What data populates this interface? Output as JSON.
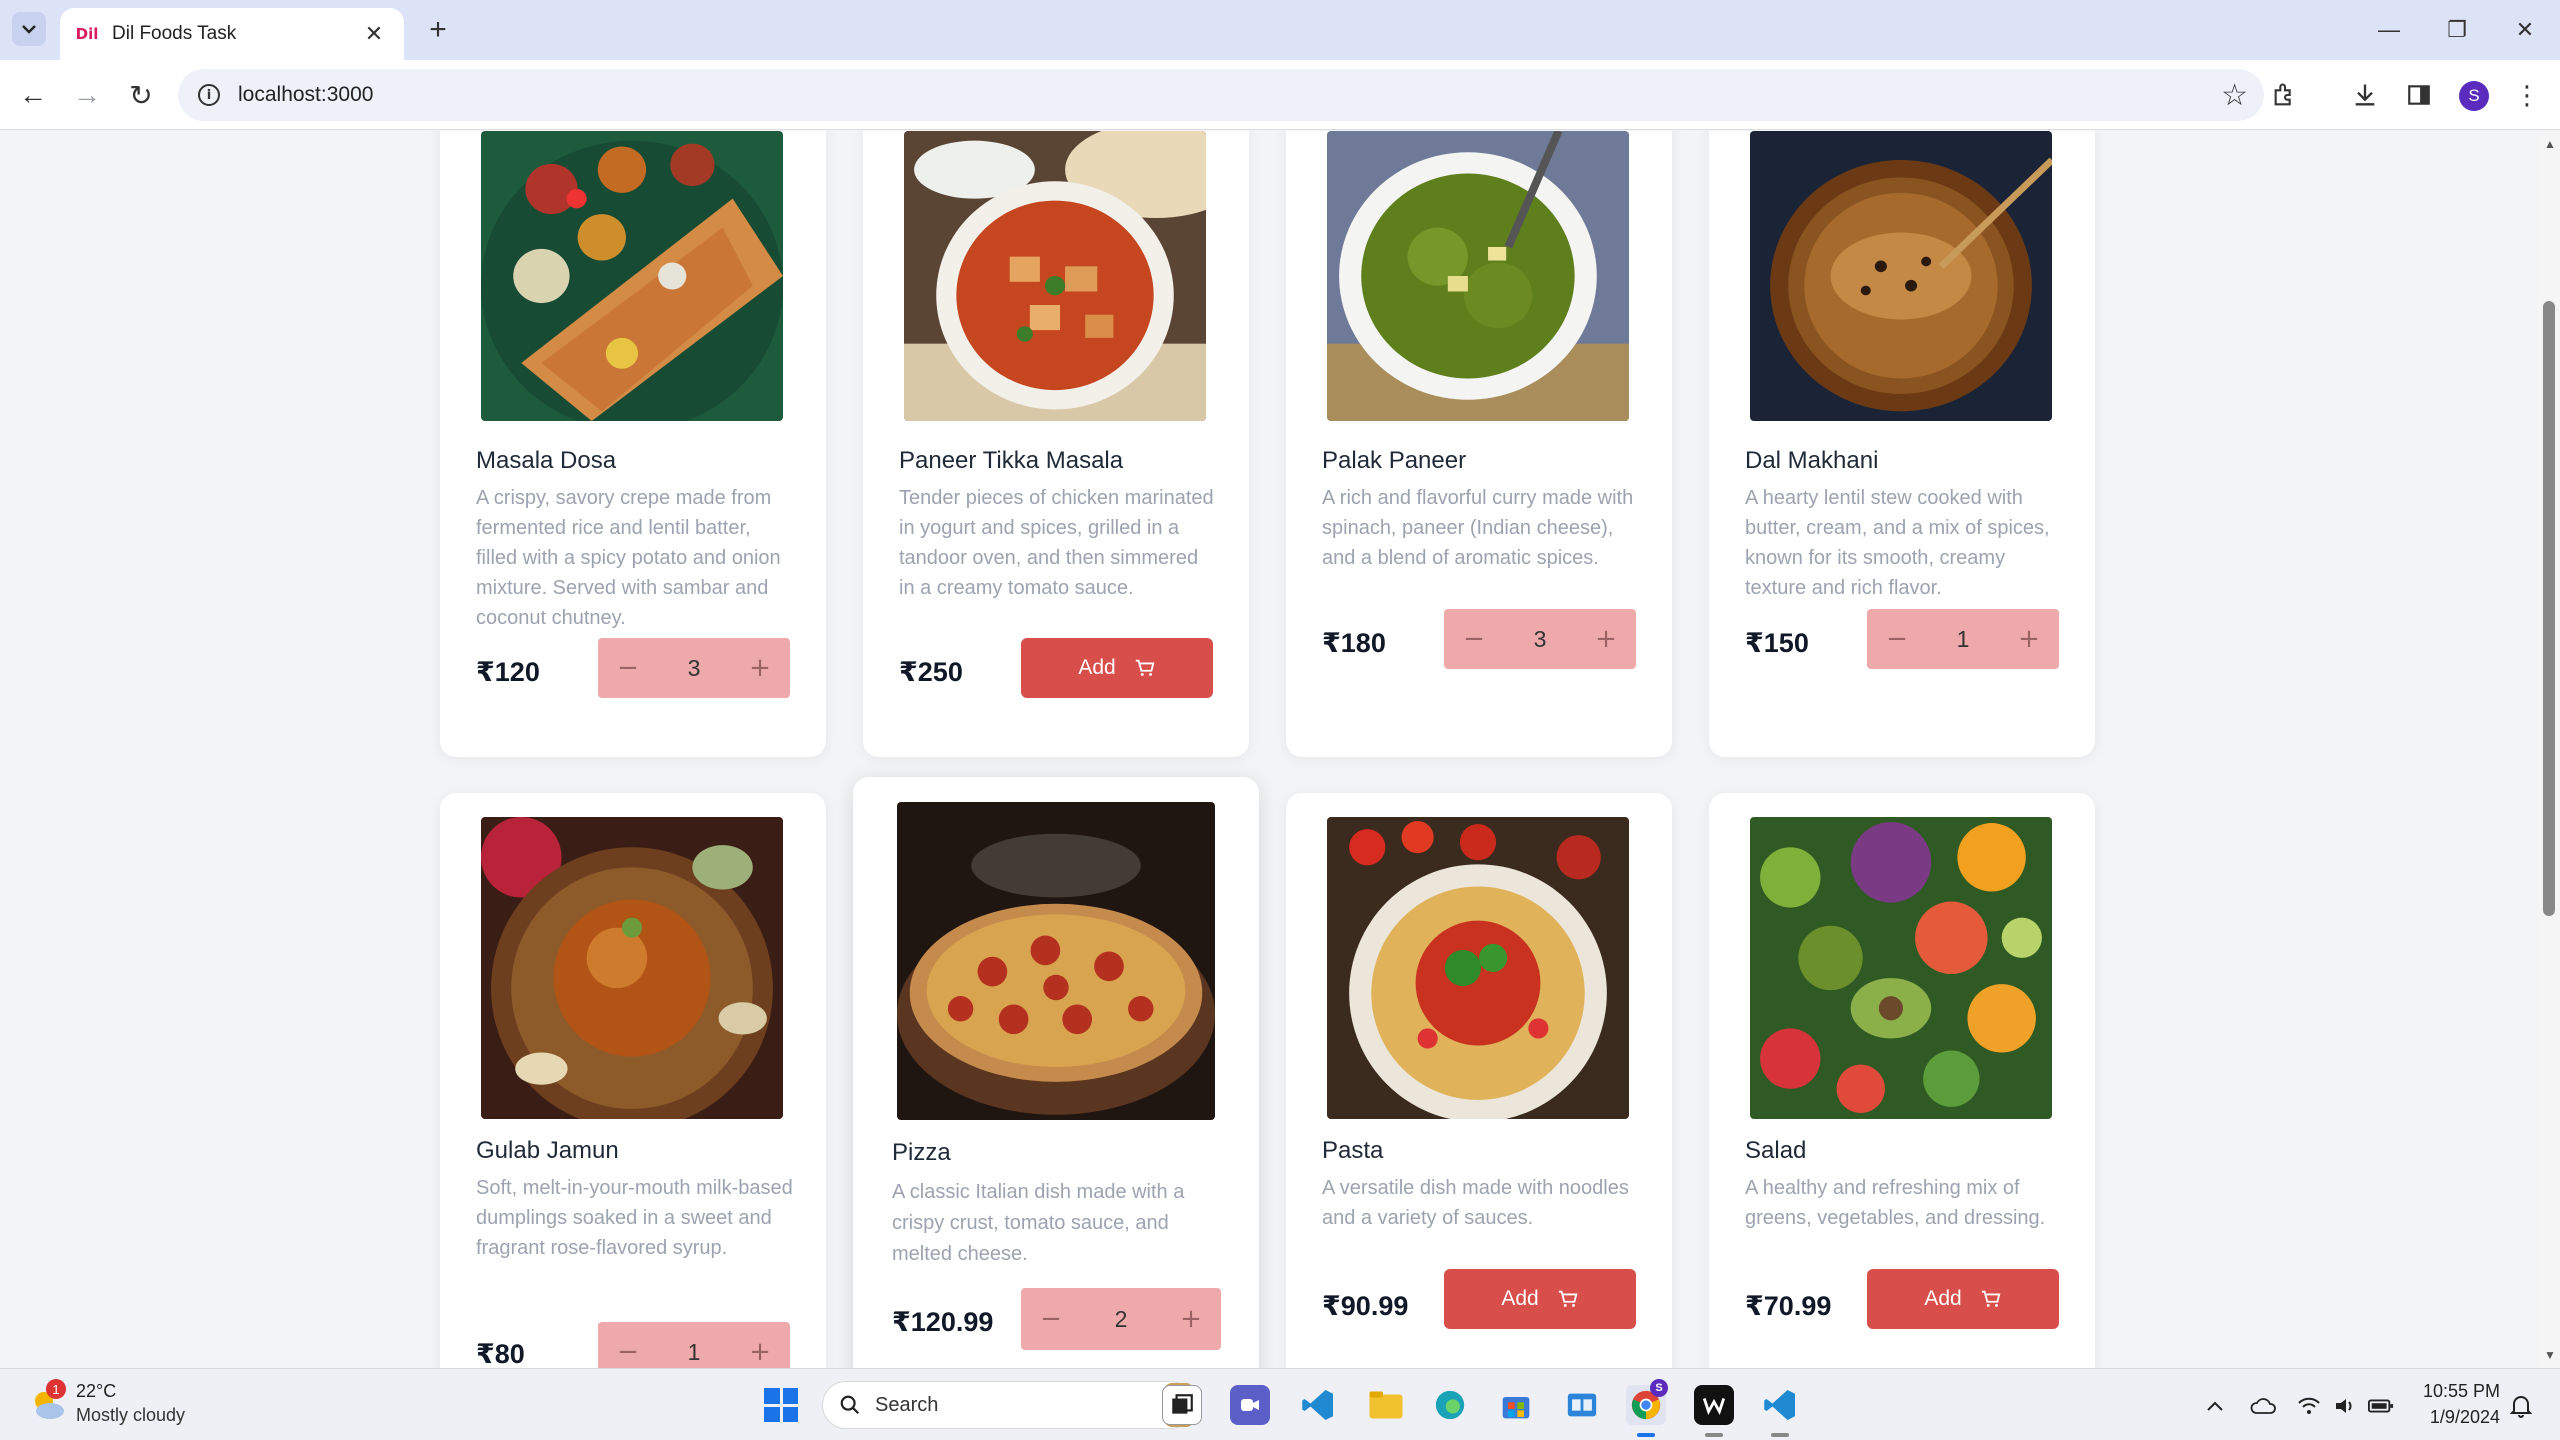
{
  "browser": {
    "tab_title": "Dil Foods Task",
    "favicon_text": "Dil",
    "url": "localhost:3000",
    "profile_initial": "S"
  },
  "menu": {
    "add_label": "Add",
    "items": [
      {
        "name": "Masala Dosa",
        "description": "A crispy, savory crepe made from fermented rice and lentil batter, filled with a spicy potato and onion mixture. Served with sambar and coconut chutney.",
        "price": "₹120",
        "in_cart": true,
        "quantity": "3"
      },
      {
        "name": "Paneer Tikka Masala",
        "description": "Tender pieces of chicken marinated in yogurt and spices, grilled in a tandoor oven, and then simmered in a creamy tomato sauce.",
        "price": "₹250",
        "in_cart": false
      },
      {
        "name": "Palak Paneer",
        "description": "A rich and flavorful curry made with spinach, paneer (Indian cheese), and a blend of aromatic spices.",
        "price": "₹180",
        "in_cart": true,
        "quantity": "3"
      },
      {
        "name": "Dal Makhani",
        "description": "A hearty lentil stew cooked with butter, cream, and a mix of spices, known for its smooth, creamy texture and rich flavor.",
        "price": "₹150",
        "in_cart": true,
        "quantity": "1"
      },
      {
        "name": "Gulab Jamun",
        "description": "Soft, melt-in-your-mouth milk-based dumplings soaked in a sweet and fragrant rose-flavored syrup.",
        "price": "₹80",
        "in_cart": true,
        "quantity": "1"
      },
      {
        "name": "Pizza",
        "description": "A classic Italian dish made with a crispy crust, tomato sauce, and melted cheese.",
        "price": "₹120.99",
        "in_cart": true,
        "quantity": "2"
      },
      {
        "name": "Pasta",
        "description": "A versatile dish made with noodles and a variety of sauces.",
        "price": "₹90.99",
        "in_cart": false
      },
      {
        "name": "Salad",
        "description": "A healthy and refreshing mix of greens, vegetables, and dressing.",
        "price": "₹70.99",
        "in_cart": false
      }
    ]
  },
  "colors": {
    "add_button": "#d84e4a",
    "stepper_bg": "#eeaaaa",
    "description_text": "#9ca3af"
  },
  "taskbar": {
    "weather_temp": "22°C",
    "weather_desc": "Mostly cloudy",
    "weather_badge": "1",
    "search_label": "Search",
    "time": "10:55 PM",
    "date": "1/9/2024",
    "chrome_badge": "S"
  }
}
